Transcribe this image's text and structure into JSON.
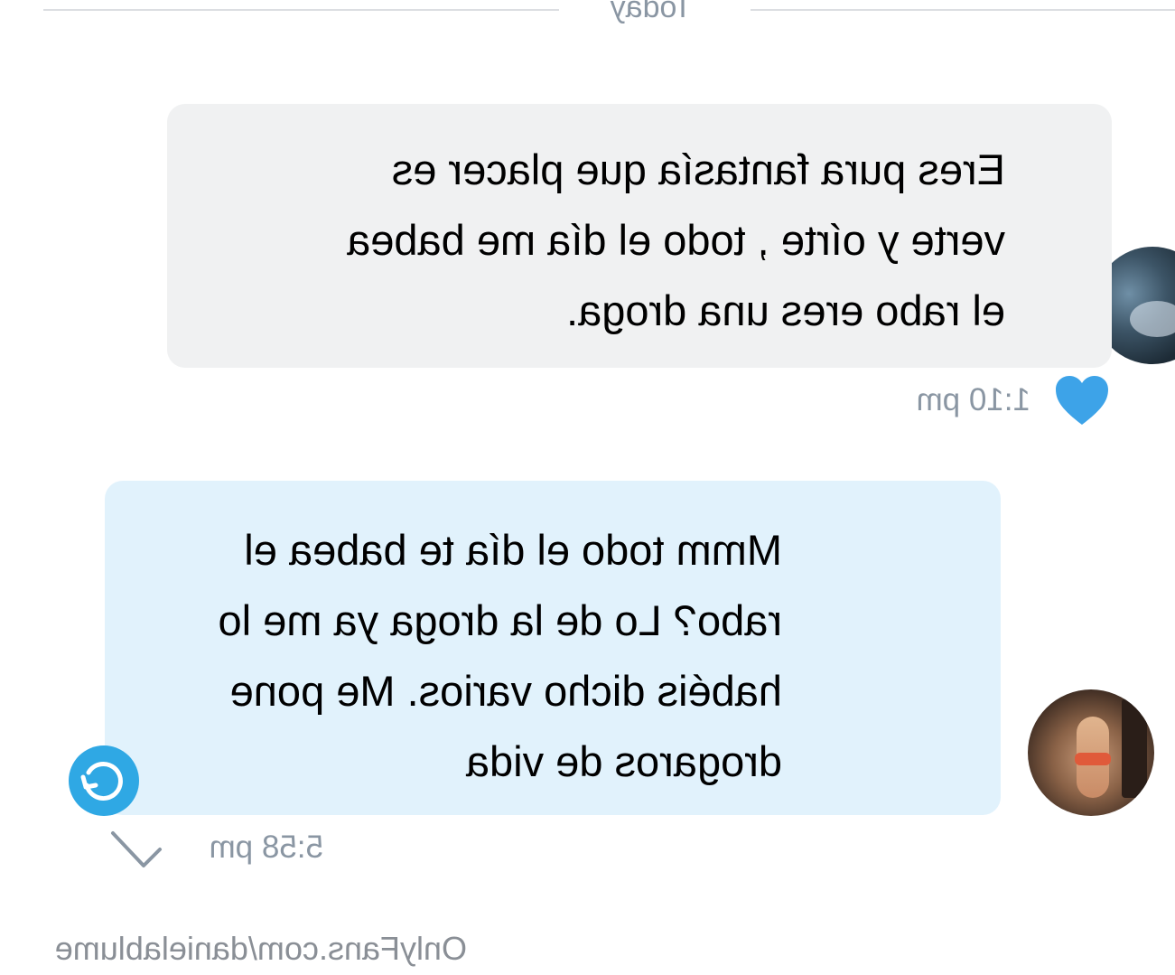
{
  "date_divider": {
    "label": "Today"
  },
  "messages": [
    {
      "type": "received",
      "text_lines": [
        "Eres pura fantasía que placer es",
        "verte y oírte , todo el día me babea",
        "el rabo eres una droga."
      ],
      "time": "1:10 pm",
      "liked": true
    },
    {
      "type": "sent",
      "text_lines": [
        "Mmm todo el día te babea el",
        "rabo? Lo de la droga ya me lo",
        "habéis dicho varios. Me pone",
        "drogaros de vida"
      ],
      "time": "5:58 pm",
      "read": true
    }
  ],
  "watermark": {
    "text": "OnlyFans.com/danielablume"
  },
  "colors": {
    "received_bubble": "#f0f1f2",
    "sent_bubble": "#e1f2fc",
    "accent": "#2fa8e4",
    "meta_text": "#8a96a3"
  },
  "icons": {
    "heart": "heart-icon",
    "check": "check-icon",
    "refresh": "refresh-icon"
  }
}
